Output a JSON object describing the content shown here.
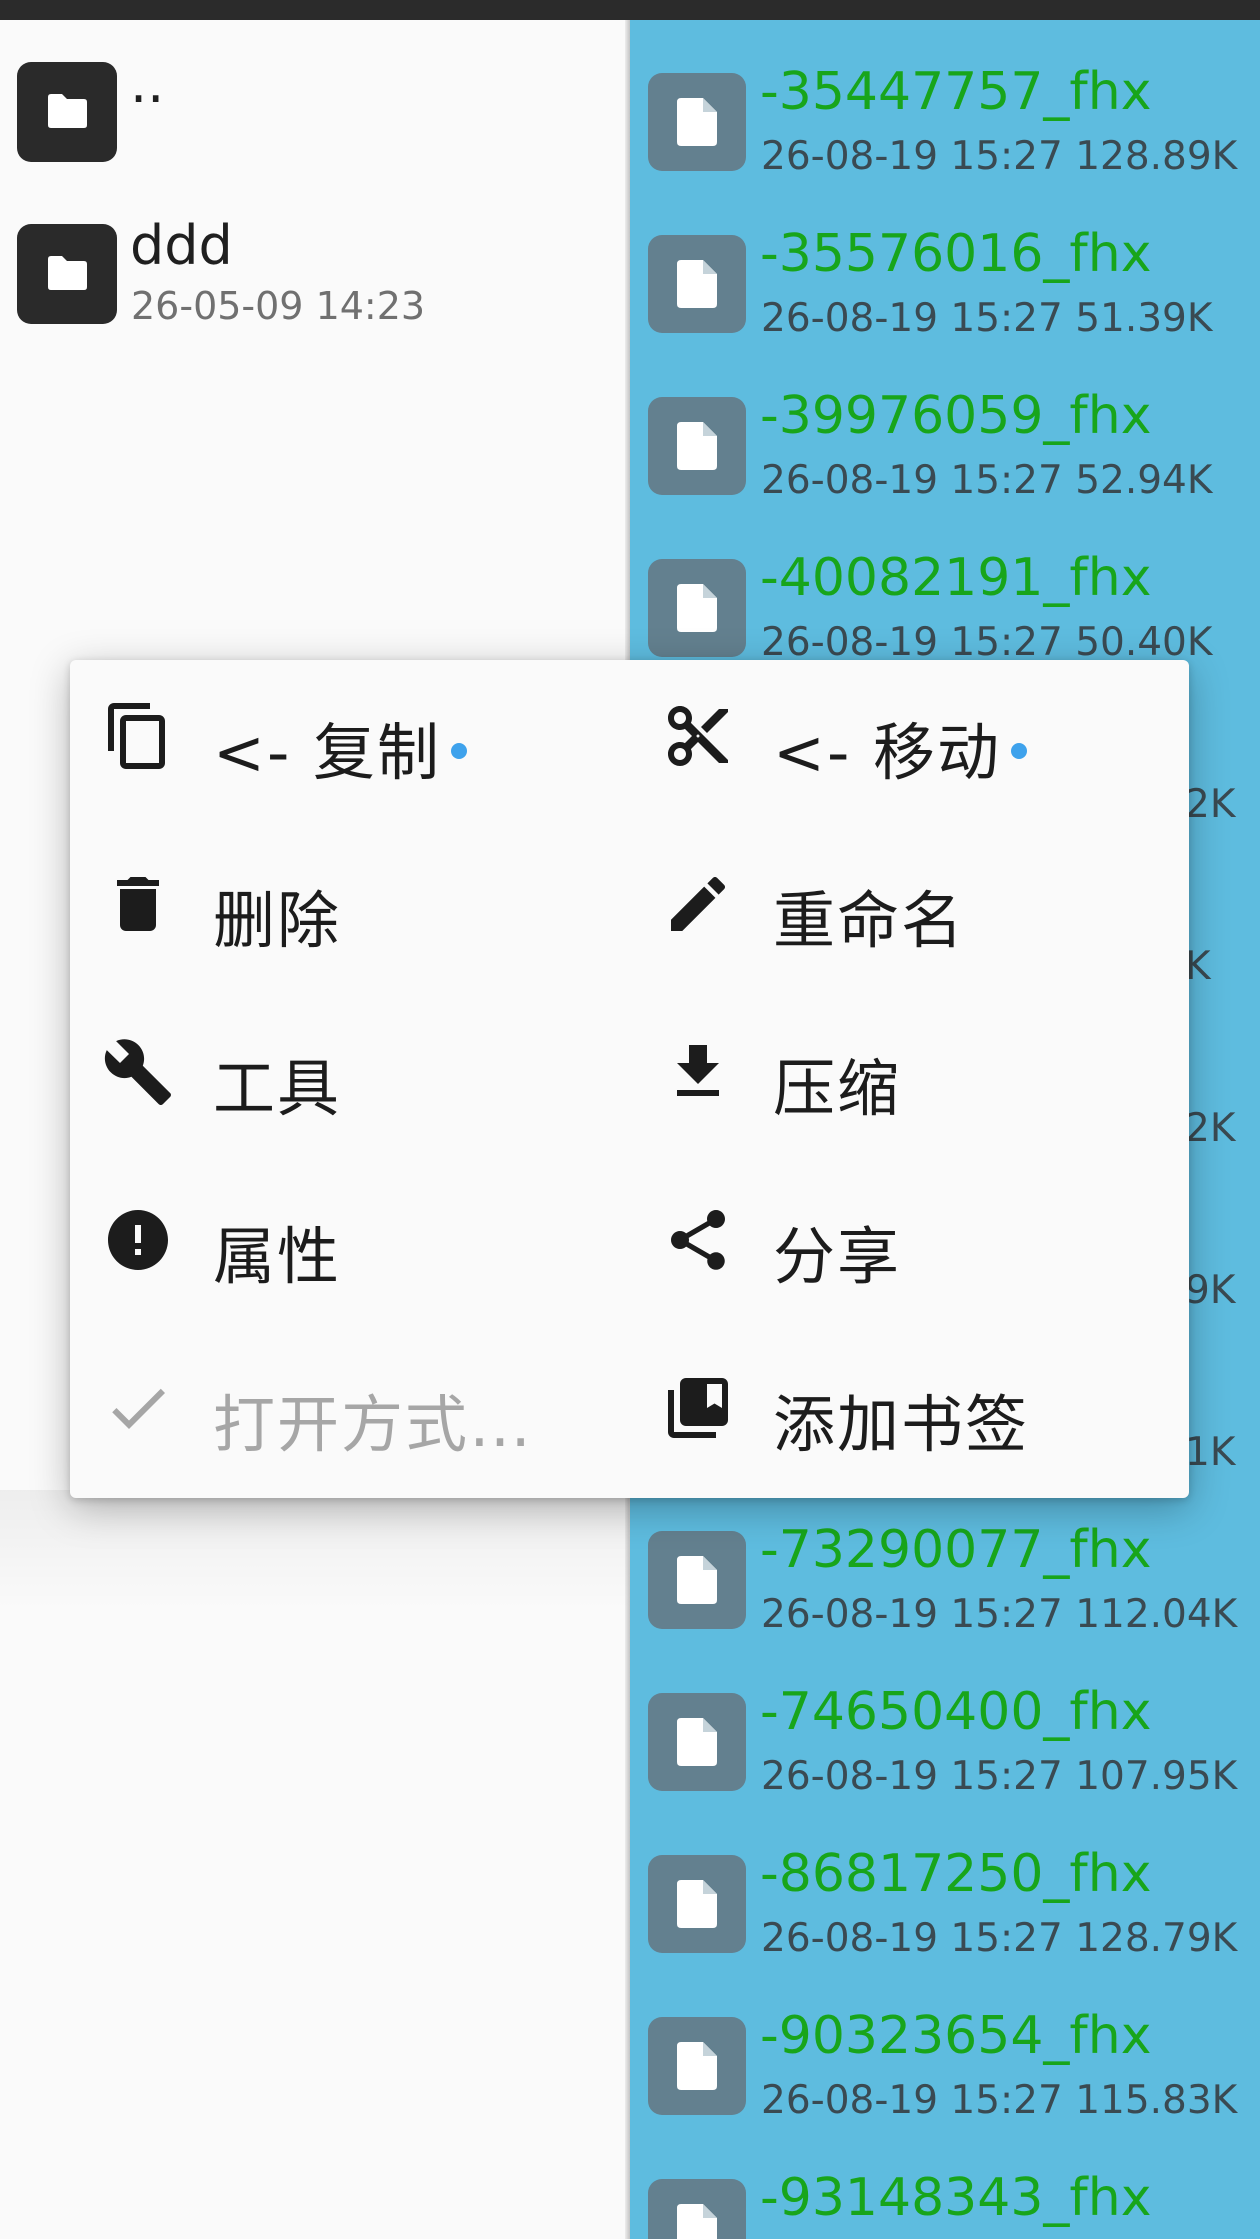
{
  "left_pane": {
    "items": [
      {
        "name": "..",
        "meta": ""
      },
      {
        "name": "ddd",
        "meta": "26-05-09 14:23"
      }
    ]
  },
  "right_pane": {
    "items": [
      {
        "name": "-35447757_fhx",
        "meta": "26-08-19 15:27  128.89K"
      },
      {
        "name": "-35576016_fhx",
        "meta": "26-08-19 15:27  51.39K"
      },
      {
        "name": "-39976059_fhx",
        "meta": "26-08-19 15:27  52.94K"
      },
      {
        "name": "-40082191_fhx",
        "meta": "26-08-19 15:27  50.40K"
      },
      {
        "name": "",
        "meta": "2K"
      },
      {
        "name": "",
        "meta": "K"
      },
      {
        "name": "",
        "meta": "2K"
      },
      {
        "name": "",
        "meta": "9K"
      },
      {
        "name": "",
        "meta": "1K"
      },
      {
        "name": "-73290077_fhx",
        "meta": "26-08-19 15:27  112.04K"
      },
      {
        "name": "-74650400_fhx",
        "meta": "26-08-19 15:27  107.95K"
      },
      {
        "name": "-86817250_fhx",
        "meta": "26-08-19 15:27  128.79K"
      },
      {
        "name": "-90323654_fhx",
        "meta": "26-08-19 15:27  115.83K"
      },
      {
        "name": "-93148343_fhx",
        "meta": ""
      }
    ]
  },
  "menu": {
    "copy": "<- 复制",
    "move": "<- 移动",
    "delete": "删除",
    "rename": "重命名",
    "tools": "工具",
    "compress": "压缩",
    "properties": "属性",
    "share": "分享",
    "open_with": "打开方式…",
    "add_bookmark": "添加书签"
  },
  "icons": {
    "copy": "copy-icon",
    "move": "scissors-icon",
    "delete": "trash-icon",
    "rename": "pencil-icon",
    "tools": "wrench-icon",
    "compress": "download-icon",
    "properties": "info-alert-icon",
    "share": "share-icon",
    "open_with": "check-icon",
    "add_bookmark": "bookmark-stack-icon"
  },
  "colors": {
    "right_pane_bg": "#5ebcdf",
    "file_name": "#18a51b",
    "indicator_dot": "#3ea2ec",
    "disabled_text": "#a6a6a6"
  }
}
